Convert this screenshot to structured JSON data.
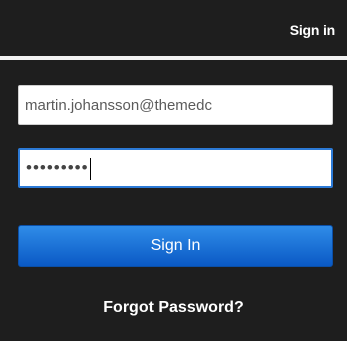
{
  "header": {
    "signin_link": "Sign in"
  },
  "form": {
    "email_value": "martin.johansson@themedc",
    "password_mask": "•••••••••",
    "signin_button": "Sign In",
    "forgot_link": "Forgot Password?"
  },
  "colors": {
    "top_bar": "#1e1e1e",
    "panel": "#1e1e1e",
    "button_top": "#2f8ce8",
    "button_bottom": "#0a59c5",
    "focus_border": "#2c7ad6"
  }
}
